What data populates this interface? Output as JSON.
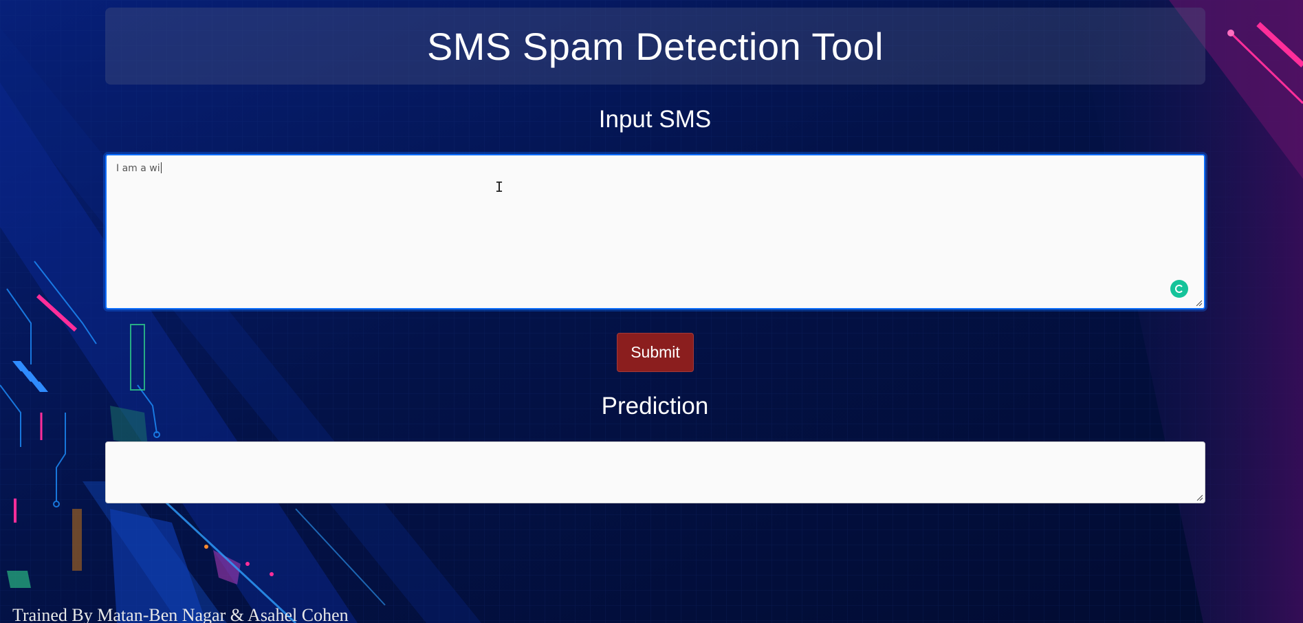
{
  "header": {
    "title": "SMS Spam Detection Tool"
  },
  "input_section": {
    "title": "Input SMS",
    "value": "I am a wi"
  },
  "submit": {
    "label": "Submit"
  },
  "prediction_section": {
    "title": "Prediction",
    "value": ""
  },
  "footer": {
    "credit": "Trained By Matan-Ben Nagar & Asahel Cohen"
  },
  "colors": {
    "background": "#020c34",
    "submit_button": "#8b1e1e",
    "accent_pink": "#ff2e9a",
    "accent_blue": "#1e90ff",
    "grammarly_green": "#15c39a"
  }
}
